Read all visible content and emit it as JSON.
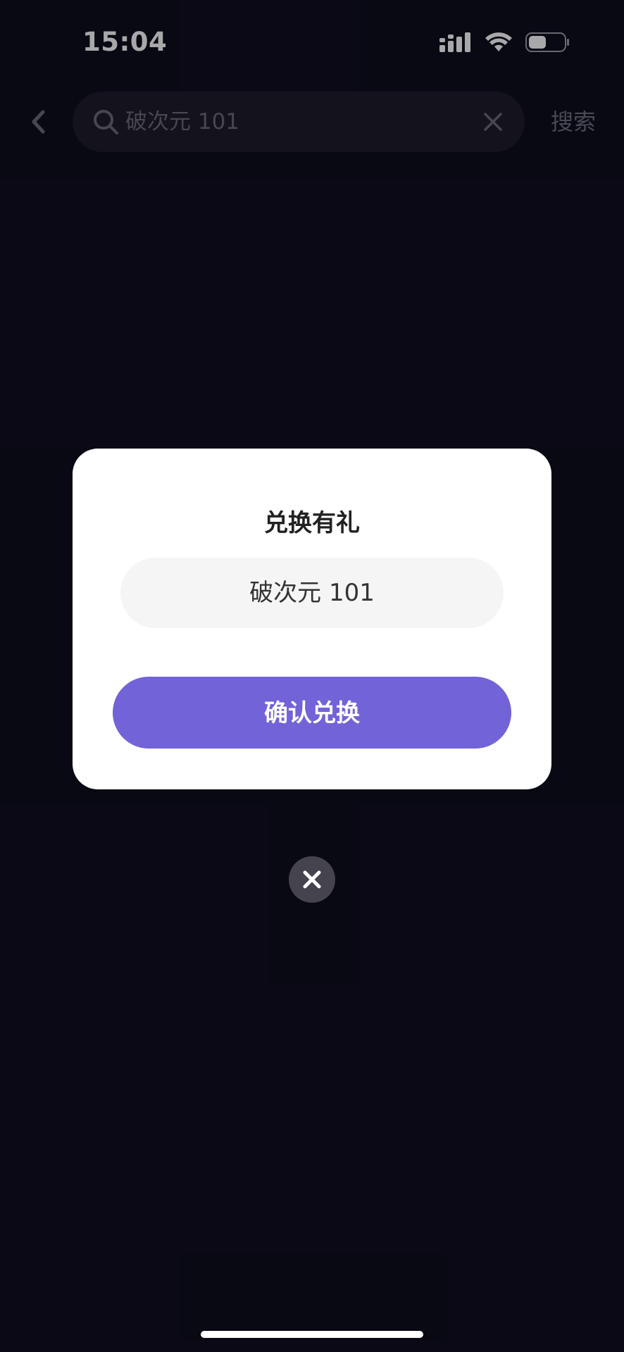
{
  "status_bar": {
    "time": "15:04",
    "icons": [
      "signal-icon",
      "wifi-icon",
      "battery-icon"
    ]
  },
  "header": {
    "back_icon": "chevron-left-icon",
    "search": {
      "value": "破次元 101",
      "icon": "search-icon",
      "clear_icon": "close-icon"
    },
    "search_button_label": "搜索"
  },
  "modal": {
    "title": "兑换有礼",
    "code_value": "破次元 101",
    "confirm_label": "确认兑换",
    "close_icon": "close-icon"
  },
  "colors": {
    "background": "#0c0b18",
    "accent": "#7263d8",
    "modal_bg": "#ffffff",
    "field_bg": "#f5f5f5"
  }
}
